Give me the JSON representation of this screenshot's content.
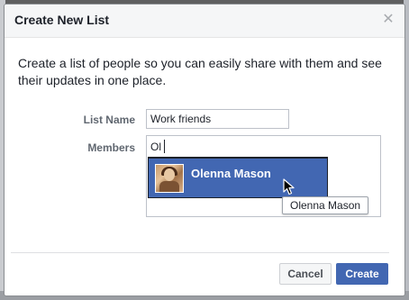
{
  "dialog": {
    "title": "Create New List",
    "close_icon": "close-icon",
    "description": "Create a list of people so you can easily share with them and see their updates in one place."
  },
  "form": {
    "list_name_label": "List Name",
    "list_name_value": "Work friends",
    "members_label": "Members",
    "members_value": "Ol"
  },
  "typeahead": {
    "suggestions": [
      {
        "name": "Olenna Mason",
        "selected": true
      }
    ],
    "tooltip": "Olenna Mason"
  },
  "buttons": {
    "cancel": "Cancel",
    "create": "Create"
  },
  "colors": {
    "primary": "#4267b2",
    "header_bg": "#f5f6f7",
    "text": "#1d2129",
    "label": "#606770"
  }
}
